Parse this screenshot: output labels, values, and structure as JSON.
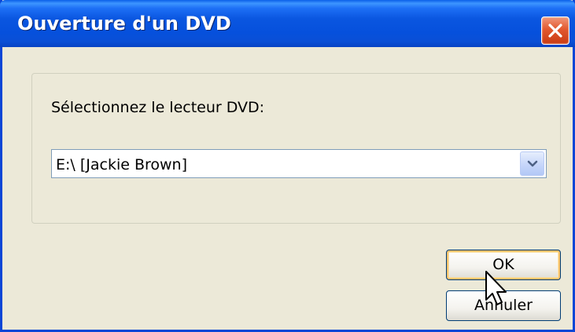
{
  "window": {
    "title": "Ouverture d'un DVD"
  },
  "dialog": {
    "prompt": "Sélectionnez le lecteur DVD:",
    "drive_select": {
      "value": "E:\\ [Jackie Brown]"
    }
  },
  "buttons": {
    "ok_label": "OK",
    "cancel_label": "Annuler"
  },
  "icons": {
    "close": "close-icon",
    "dropdown": "chevron-down-icon",
    "cursor": "mouse-pointer-icon"
  },
  "colors": {
    "titlebar": "#0a56e0",
    "close_button": "#e2582f",
    "dialog_background": "#ece9d8",
    "default_button_focus": "#f8c36b"
  }
}
